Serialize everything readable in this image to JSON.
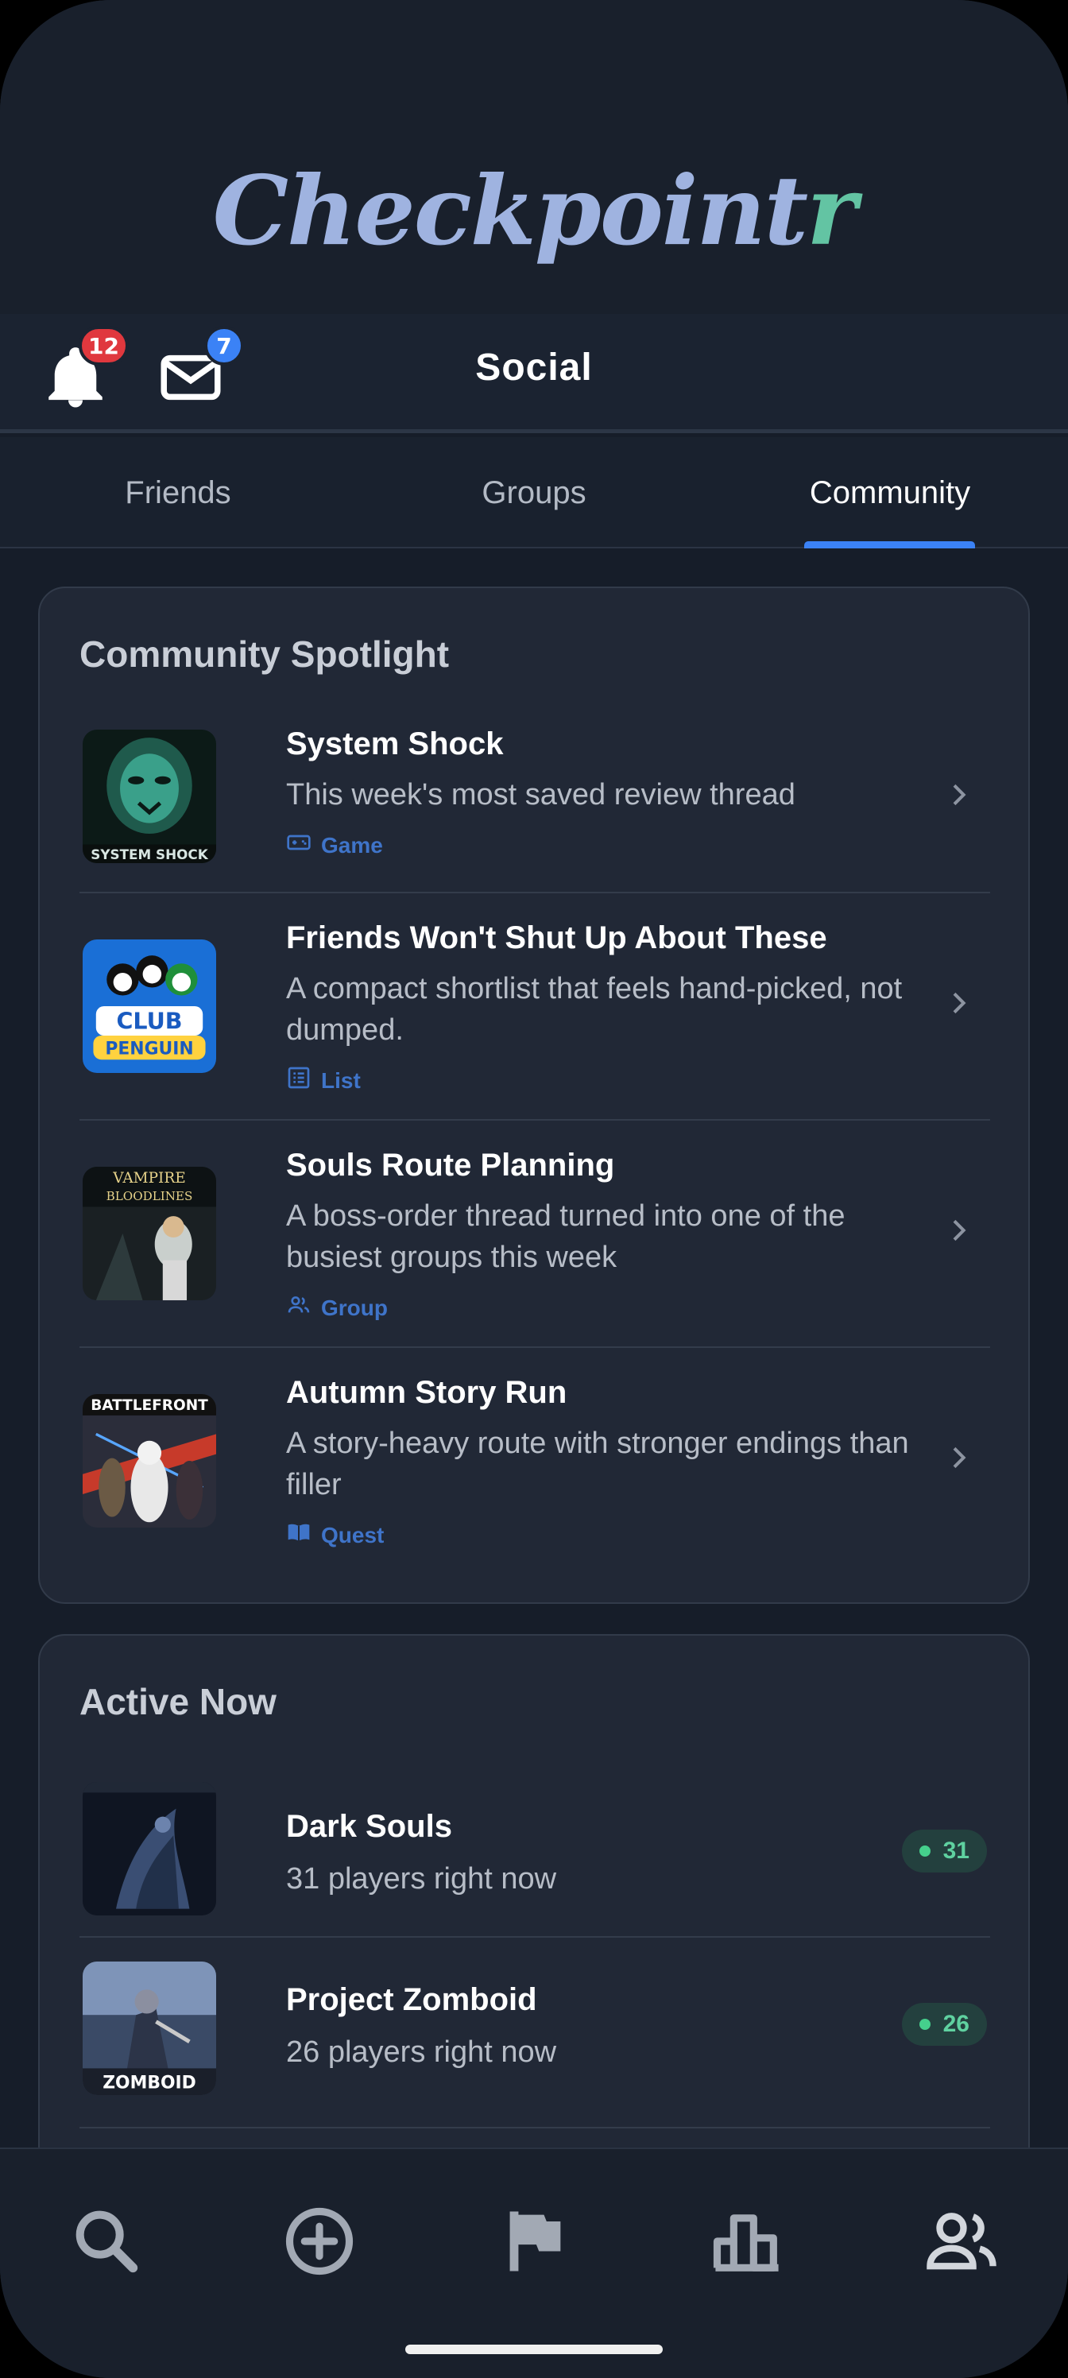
{
  "app": {
    "logo_text_main": "Checkpoint",
    "logo_text_accent": "r"
  },
  "header": {
    "title": "Social",
    "notifications_count": "12",
    "messages_count": "7",
    "notifications_icon": "bell-icon",
    "messages_icon": "mail-icon"
  },
  "tabs": [
    {
      "label": "Friends",
      "active": false
    },
    {
      "label": "Groups",
      "active": false
    },
    {
      "label": "Community",
      "active": true
    }
  ],
  "spotlight": {
    "title": "Community Spotlight",
    "items": [
      {
        "title": "System Shock",
        "desc": "This week's most saved review thread",
        "type": "Game",
        "type_icon": "gamepad-icon",
        "thumb": "system-shock-cover"
      },
      {
        "title": "Friends Won't Shut Up About These",
        "desc": "A compact shortlist that feels hand-picked, not dumped.",
        "type": "List",
        "type_icon": "list-icon",
        "thumb": "club-penguin-cover"
      },
      {
        "title": "Souls Route Planning",
        "desc": "A boss-order thread turned into one of the busiest groups this week",
        "type": "Group",
        "type_icon": "group-icon",
        "thumb": "vampire-bloodlines-cover"
      },
      {
        "title": "Autumn Story Run",
        "desc": "A story-heavy route with stronger endings than filler",
        "type": "Quest",
        "type_icon": "book-icon",
        "thumb": "battlefront-cover"
      }
    ]
  },
  "active_now": {
    "title": "Active Now",
    "items": [
      {
        "title": "Dark Souls",
        "desc": "31 players right now",
        "count": "31",
        "thumb": "dark-souls-cover"
      },
      {
        "title": "Project Zomboid",
        "desc": "26 players right now",
        "count": "26",
        "thumb": "project-zomboid-cover"
      }
    ]
  },
  "bottom_nav": [
    {
      "icon": "search-icon"
    },
    {
      "icon": "add-circle-icon"
    },
    {
      "icon": "flag-icon"
    },
    {
      "icon": "leaderboard-icon"
    },
    {
      "icon": "people-icon"
    }
  ],
  "colors": {
    "accent": "#3b82f6",
    "online": "#45d08c",
    "badge_red": "#e0383e",
    "type_label": "#3f74c9"
  }
}
